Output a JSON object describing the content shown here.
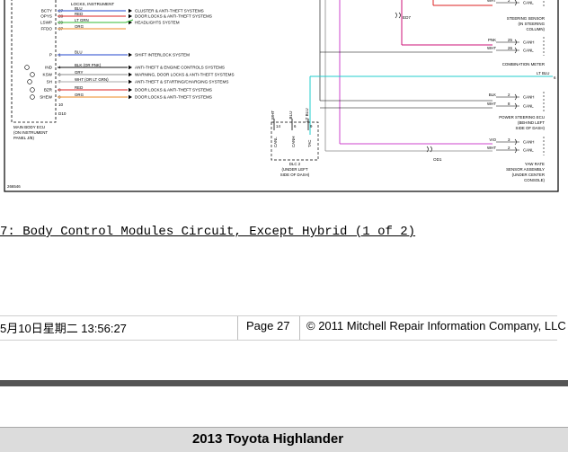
{
  "diagram": {
    "left_pins": [
      {
        "label": "BCTY",
        "pin": "27",
        "wire": "BLU",
        "target": "CLUSTER & ANTI-THEFT SYSTEMS",
        "color": "#2244cc"
      },
      {
        "label": "OPYS",
        "pin": "28",
        "wire": "RED",
        "target": "DOOR LOCKS & ANTI-THEFT SYSTEMS",
        "color": "#dd2222"
      },
      {
        "label": "LSWP",
        "pin": "29",
        "wire": "LT GRN",
        "target": "HEADLIGHTS SYSTEM",
        "color": "#33bb33"
      },
      {
        "label": "FFDO",
        "pin": "37",
        "wire": "ORG",
        "target": "",
        "color": "#ee8822"
      }
    ],
    "top_note": "LOCKS, INSTRUMENT",
    "shift_row": {
      "label": "P",
      "pin": "1",
      "wire": "BLU",
      "target": "SHIFT INTERLOCK SYSTEM"
    },
    "lower_pins": [
      {
        "label": "IND",
        "pin": "4",
        "wire": "BLK (OR PNK)",
        "target": "ANTI-THEFT & ENGINE CONTROLS SYSTEMS"
      },
      {
        "label": "KSW",
        "pin": "6",
        "wire": "GRY",
        "target": "WARNING, DOOR LOCKS & ANTI-THEFT SYSTEMS"
      },
      {
        "label": "SH",
        "pin": "7",
        "wire": "WHT (OR LT GRN)",
        "target": "ANTI-THEFT & STARTING/CHARGING SYSTEMS"
      },
      {
        "label": "BZR",
        "pin": "8",
        "wire": "RED",
        "target": "DOOR LOCKS & ANTI-THEFT SYSTEMS"
      },
      {
        "label": "SHEW",
        "pin": "9",
        "wire": "ORG",
        "target": "DOOR LOCKS & ANTI-THEFT SYSTEMS"
      }
    ],
    "tail_pins": [
      "10",
      "D10"
    ],
    "ecu_label": [
      "MAIN BODY ECU",
      "(ON INSTRUMENT",
      "PANEL J/B)"
    ],
    "mid_wires": [
      "WHT",
      "BLU",
      "LT BLU"
    ],
    "dlc_pins": [
      "14",
      "6",
      "9"
    ],
    "dlc_names": [
      "CANL",
      "CANH",
      "TAC"
    ],
    "dlc_label": [
      "DLC 2",
      "(UNDER LEFT",
      "SIDE OF DASH)"
    ],
    "connectors": [
      "ED7",
      "OD1"
    ],
    "right_components": [
      {
        "wires": [
          [
            "WHT",
            "2",
            "CANL"
          ]
        ],
        "label": [
          "STEERING SENSOR",
          "(IN STEERING",
          "COLUMN)"
        ]
      },
      {
        "wires": [
          [
            "PNK",
            "25",
            "CANH"
          ],
          [
            "WHT",
            "26",
            "CANL"
          ]
        ],
        "label": [
          "COMBINATION METER"
        ]
      },
      {
        "wires": [
          [
            "BLK",
            "2",
            "CANH"
          ],
          [
            "WHT",
            "8",
            "CANL"
          ]
        ],
        "label": [
          "POWER STEERING ECU",
          "(BEHIND LEFT",
          "SIDE OF DASH)"
        ]
      },
      {
        "wires": [
          [
            "VIO",
            "3",
            "CANH"
          ],
          [
            "WHT",
            "2",
            "CANL"
          ]
        ],
        "label": [
          "YAW RATE",
          "SENSOR ASSEMBLY",
          "(UNDER CENTER",
          "CONSOLE)"
        ]
      }
    ],
    "lt_blu_label": "LT BLU",
    "figure_id": "266546"
  },
  "caption": "7: Body Control Modules Circuit, Except Hybrid (1 of 2)",
  "footer": {
    "datetime": "5月10日星期二  13:56:27",
    "page": "Page 27",
    "copyright": "© 2011 Mitchell Repair Information Company, LLC"
  },
  "vehicle_title": "2013 Toyota Highlander"
}
